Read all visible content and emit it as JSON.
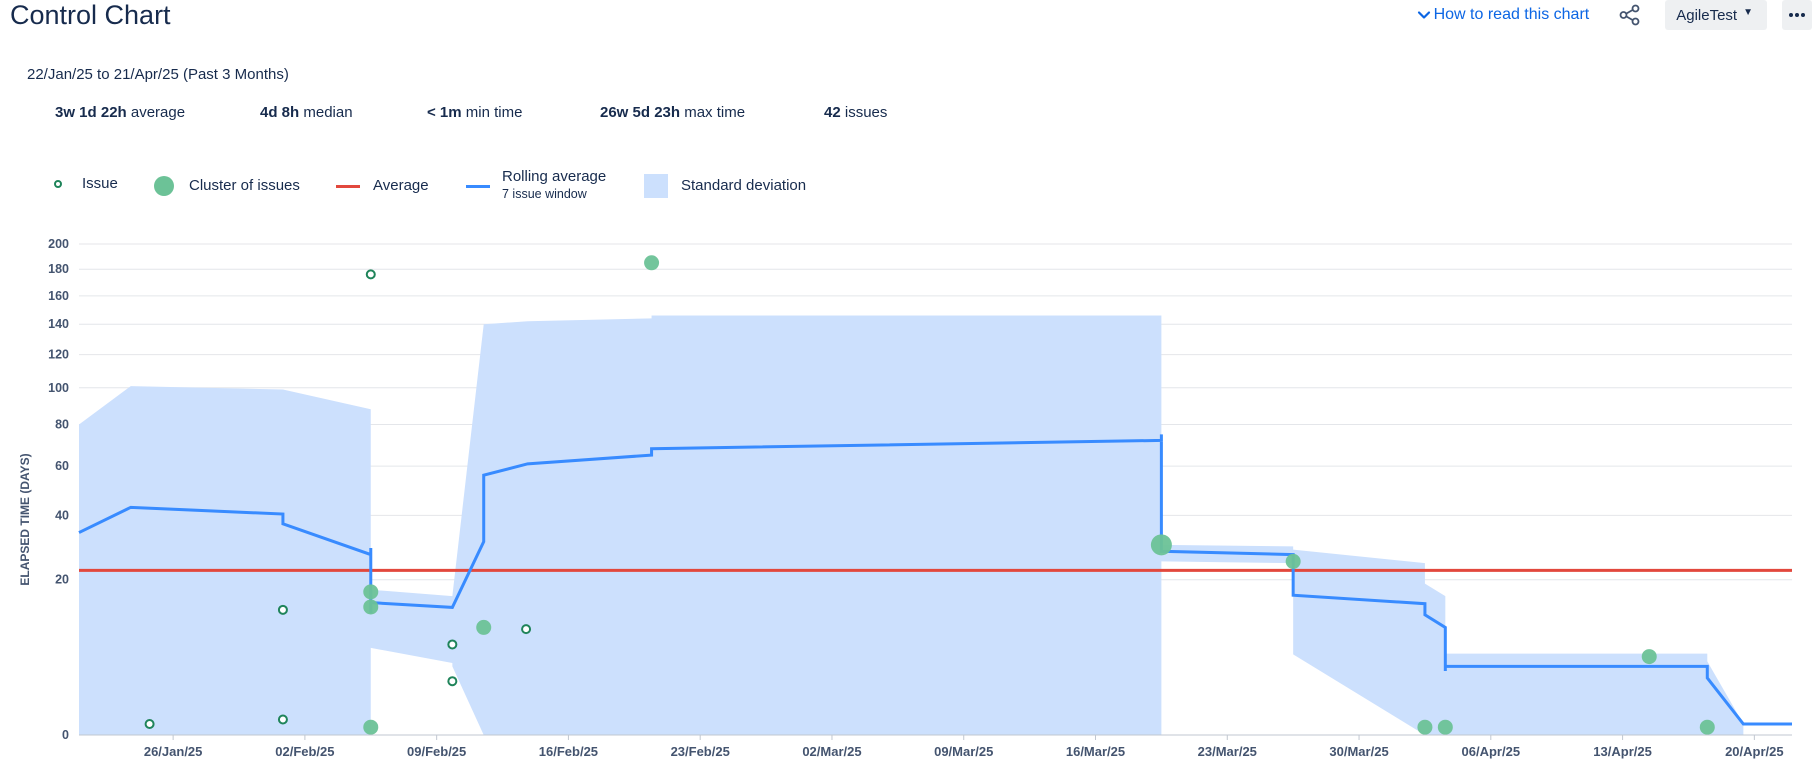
{
  "header": {
    "title": "Control Chart",
    "how_to_read": "How to read this chart",
    "board": "AgileTest",
    "more": "•••"
  },
  "date_range": "22/Jan/25 to 21/Apr/25 (Past 3 Months)",
  "stats": [
    {
      "value": "3w 1d 22h",
      "label": "average"
    },
    {
      "value": "4d 8h",
      "label": "median"
    },
    {
      "value": "< 1m",
      "label": "min time"
    },
    {
      "value": "26w 5d 23h",
      "label": "max time"
    },
    {
      "value": "42",
      "label": "issues"
    }
  ],
  "legend": {
    "issue": "Issue",
    "cluster": "Cluster of issues",
    "average": "Average",
    "rolling": "Rolling average",
    "rolling_sub": "7 issue window",
    "std": "Standard deviation"
  },
  "colors": {
    "issue": "#1f845a",
    "cluster": "#6cc297",
    "average": "#e2483d",
    "rolling": "#388bff",
    "std": "#cce0fd",
    "link": "#0c66e4"
  },
  "chart_data": {
    "type": "scatter",
    "ylabel": "ELAPSED TIME (DAYS)",
    "y_scale": "sqrt",
    "ylim": [
      0,
      200
    ],
    "y_ticks": [
      0,
      20,
      40,
      60,
      80,
      100,
      120,
      140,
      160,
      180,
      200
    ],
    "xlim": [
      "2025-01-21",
      "2025-04-22"
    ],
    "x_ticks": [
      {
        "date": "2025-01-26",
        "label": "26/Jan/25"
      },
      {
        "date": "2025-02-02",
        "label": "02/Feb/25"
      },
      {
        "date": "2025-02-09",
        "label": "09/Feb/25"
      },
      {
        "date": "2025-02-16",
        "label": "16/Feb/25"
      },
      {
        "date": "2025-02-23",
        "label": "23/Feb/25"
      },
      {
        "date": "2025-03-02",
        "label": "02/Mar/25"
      },
      {
        "date": "2025-03-09",
        "label": "09/Mar/25"
      },
      {
        "date": "2025-03-16",
        "label": "16/Mar/25"
      },
      {
        "date": "2025-03-23",
        "label": "23/Mar/25"
      },
      {
        "date": "2025-03-30",
        "label": "30/Mar/25"
      },
      {
        "date": "2025-04-06",
        "label": "06/Apr/25"
      },
      {
        "date": "2025-04-13",
        "label": "13/Apr/25"
      },
      {
        "date": "2025-04-20",
        "label": "20/Apr/25"
      }
    ],
    "average": 22.5,
    "issues": [
      {
        "x": "2025-01-24T18:00",
        "y": 0.1
      },
      {
        "x": "2025-01-31T20:00",
        "y": 13
      },
      {
        "x": "2025-01-31T20:00",
        "y": 0.2
      },
      {
        "x": "2025-02-05T12:00",
        "y": 176
      },
      {
        "x": "2025-02-09T20:00",
        "y": 6.8
      },
      {
        "x": "2025-02-09T20:00",
        "y": 2.4
      },
      {
        "x": "2025-02-13T18:00",
        "y": 9.3
      }
    ],
    "clusters": [
      {
        "x": "2025-02-05T12:00",
        "y": 17,
        "size": 1
      },
      {
        "x": "2025-02-05T12:00",
        "y": 13.6,
        "size": 1
      },
      {
        "x": "2025-02-05T12:00",
        "y": 0.05,
        "size": 1
      },
      {
        "x": "2025-02-11T12:00",
        "y": 9.6,
        "size": 1
      },
      {
        "x": "2025-02-20T10:00",
        "y": 185,
        "size": 1
      },
      {
        "x": "2025-03-19T12:00",
        "y": 30,
        "size": 2
      },
      {
        "x": "2025-03-26T12:00",
        "y": 25,
        "size": 1
      },
      {
        "x": "2025-04-02T12:00",
        "y": 0.05,
        "size": 1
      },
      {
        "x": "2025-04-03T14:00",
        "y": 0.05,
        "size": 1
      },
      {
        "x": "2025-04-14T10:00",
        "y": 5.1,
        "size": 1
      },
      {
        "x": "2025-04-17T12:00",
        "y": 0.05,
        "size": 1
      }
    ],
    "rolling_average": [
      {
        "x": "2025-01-21T00:00",
        "y": 34
      },
      {
        "x": "2025-01-23T18:00",
        "y": 43
      },
      {
        "x": "2025-01-31T20:00",
        "y": 40.5
      },
      {
        "x": "2025-01-31T20:00",
        "y": 37
      },
      {
        "x": "2025-02-05T12:00",
        "y": 27
      },
      {
        "x": "2025-02-05T12:00",
        "y": 29
      },
      {
        "x": "2025-02-05T12:00",
        "y": 12.3
      },
      {
        "x": "2025-02-05T12:00",
        "y": 14.5
      },
      {
        "x": "2025-02-05T16:00",
        "y": 14.5
      },
      {
        "x": "2025-02-09T20:00",
        "y": 13.5
      },
      {
        "x": "2025-02-11T12:00",
        "y": 31
      },
      {
        "x": "2025-02-11T12:00",
        "y": 56
      },
      {
        "x": "2025-02-13T20:00",
        "y": 61
      },
      {
        "x": "2025-02-20T10:00",
        "y": 65
      },
      {
        "x": "2025-02-20T10:00",
        "y": 68
      },
      {
        "x": "2025-03-19T12:00",
        "y": 72
      },
      {
        "x": "2025-03-19T12:00",
        "y": 75
      },
      {
        "x": "2025-03-19T12:00",
        "y": 28
      },
      {
        "x": "2025-03-26T12:00",
        "y": 27
      },
      {
        "x": "2025-03-26T12:00",
        "y": 16.2
      },
      {
        "x": "2025-04-02T12:00",
        "y": 14.3
      },
      {
        "x": "2025-04-02T12:00",
        "y": 12
      },
      {
        "x": "2025-04-03T14:00",
        "y": 9.6
      },
      {
        "x": "2025-04-03T14:00",
        "y": 3.4
      },
      {
        "x": "2025-04-03T14:00",
        "y": 3.9
      },
      {
        "x": "2025-04-17T12:00",
        "y": 3.9
      },
      {
        "x": "2025-04-17T12:00",
        "y": 2.7
      },
      {
        "x": "2025-04-19T10:00",
        "y": 0.1
      },
      {
        "x": "2025-04-22T00:00",
        "y": 0.1
      }
    ],
    "std_band": [
      {
        "x": "2025-01-21T00:00",
        "upper": 80,
        "lower": 0
      },
      {
        "x": "2025-01-23T18:00",
        "upper": 101,
        "lower": 0
      },
      {
        "x": "2025-01-31T20:00",
        "upper": 99,
        "lower": 0
      },
      {
        "x": "2025-02-05T12:00",
        "upper": 88,
        "lower": 0
      },
      {
        "x": "2025-02-05T12:00",
        "upper": 17.5,
        "lower": 6.3
      },
      {
        "x": "2025-02-09T20:00",
        "upper": 16,
        "lower": 4.3
      },
      {
        "x": "2025-02-09T20:00",
        "upper": 16,
        "lower": 3.9
      },
      {
        "x": "2025-02-11T12:00",
        "upper": 140,
        "lower": 0
      },
      {
        "x": "2025-02-13T20:00",
        "upper": 142,
        "lower": 0
      },
      {
        "x": "2025-02-20T10:00",
        "upper": 144,
        "lower": 0
      },
      {
        "x": "2025-02-20T10:00",
        "upper": 146,
        "lower": 0
      },
      {
        "x": "2025-03-19T12:00",
        "upper": 146,
        "lower": 0
      },
      {
        "x": "2025-03-19T12:00",
        "upper": 30,
        "lower": 25
      },
      {
        "x": "2025-03-26T12:00",
        "upper": 29.5,
        "lower": 24.5
      },
      {
        "x": "2025-03-26T12:00",
        "upper": 28.5,
        "lower": 5.4
      },
      {
        "x": "2025-04-02T12:00",
        "upper": 24.5,
        "lower": 0
      },
      {
        "x": "2025-04-02T12:00",
        "upper": 19,
        "lower": 0
      },
      {
        "x": "2025-04-03T14:00",
        "upper": 16,
        "lower": 0
      },
      {
        "x": "2025-04-03T14:00",
        "upper": 5.5,
        "lower": 0
      },
      {
        "x": "2025-04-17T12:00",
        "upper": 5.5,
        "lower": 0
      },
      {
        "x": "2025-04-17T12:00",
        "upper": 4.5,
        "lower": 0
      },
      {
        "x": "2025-04-19T10:00",
        "upper": 0.1,
        "lower": 0
      }
    ],
    "legend_position": "top-left",
    "grid": true
  }
}
